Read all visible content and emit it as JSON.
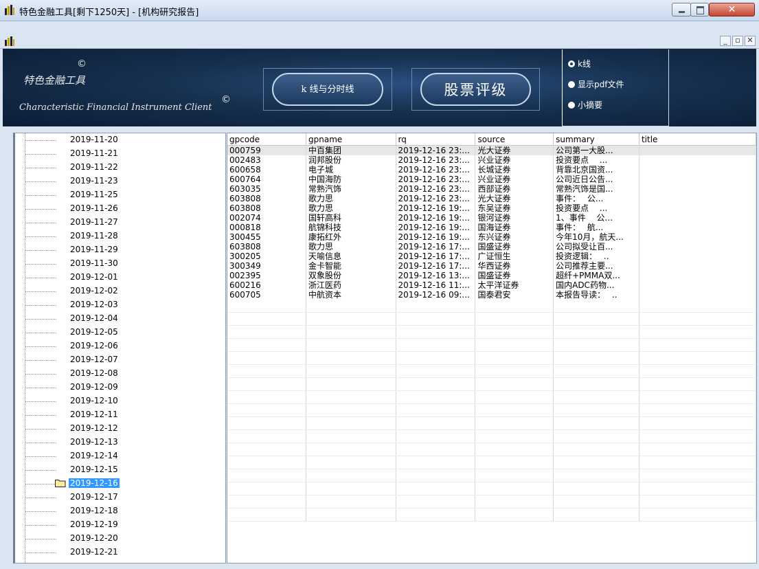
{
  "window": {
    "title": "特色金融工具[剩下1250天] - [机构研究报告]"
  },
  "banner": {
    "logo_cn": "特色金融工具",
    "logo_copyright_1": "©",
    "logo_en": "Characteristic Financial Instrument Client",
    "logo_copyright_2": "©",
    "btn_kline": "k 线与分时线",
    "btn_rating": "股票评级",
    "radios": [
      {
        "label": "k线",
        "selected": true
      },
      {
        "label": "显示pdf文件",
        "selected": false
      },
      {
        "label": "小摘要",
        "selected": false
      }
    ]
  },
  "tree": {
    "items": [
      "2019-11-20",
      "2019-11-21",
      "2019-11-22",
      "2019-11-23",
      "2019-11-25",
      "2019-11-26",
      "2019-11-27",
      "2019-11-28",
      "2019-11-29",
      "2019-11-30",
      "2019-12-01",
      "2019-12-02",
      "2019-12-03",
      "2019-12-04",
      "2019-12-05",
      "2019-12-06",
      "2019-12-07",
      "2019-12-08",
      "2019-12-09",
      "2019-12-10",
      "2019-12-11",
      "2019-12-12",
      "2019-12-13",
      "2019-12-14",
      "2019-12-15",
      "2019-12-16",
      "2019-12-17",
      "2019-12-18",
      "2019-12-19",
      "2019-12-20",
      "2019-12-21"
    ],
    "selected": "2019-12-16"
  },
  "grid": {
    "columns": [
      "gpcode",
      "gpname",
      "rq",
      "source",
      "summary",
      "title"
    ],
    "rows": [
      [
        "000759",
        "中百集团",
        "2019-12-16 23:...",
        "光大证券",
        "公司第一大股...",
        ""
      ],
      [
        "002483",
        "润邦股份",
        "2019-12-16 23:...",
        "兴业证券",
        "投资要点　 ...",
        ""
      ],
      [
        "600658",
        "电子城",
        "2019-12-16 23:...",
        "长城证券",
        "背靠北京国资...",
        ""
      ],
      [
        "600764",
        "中国海防",
        "2019-12-16 23:...",
        "兴业证券",
        "公司近日公告...",
        ""
      ],
      [
        "603035",
        "常熟汽饰",
        "2019-12-16 23:...",
        "西部证券",
        "常熟汽饰是国...",
        ""
      ],
      [
        "603808",
        "歌力思",
        "2019-12-16 23:...",
        "光大证券",
        "事件：　 公...",
        ""
      ],
      [
        "603808",
        "歌力思",
        "2019-12-16 19:...",
        "东吴证券",
        "投资要点　 ...",
        ""
      ],
      [
        "002074",
        "国轩高科",
        "2019-12-16 19:...",
        "银河证券",
        "1、事件　 公...",
        ""
      ],
      [
        "000818",
        "航锦科技",
        "2019-12-16 19:...",
        "国海证券",
        "事件：　 航...",
        ""
      ],
      [
        "300455",
        "康拓红外",
        "2019-12-16 19:...",
        "东兴证券",
        "今年10月，航天...",
        ""
      ],
      [
        "603808",
        "歌力思",
        "2019-12-16 17:...",
        "国盛证券",
        "公司拟受让百...",
        ""
      ],
      [
        "300205",
        "天喻信息",
        "2019-12-16 17:...",
        "广证恒生",
        "投资逻辑：　 ..",
        ""
      ],
      [
        "300349",
        "金卡智能",
        "2019-12-16 17:...",
        "华西证券",
        "公司推荐主要...",
        ""
      ],
      [
        "002395",
        "双象股份",
        "2019-12-16 13:...",
        "国盛证券",
        "超纤+PMMA双...",
        ""
      ],
      [
        "600216",
        "浙江医药",
        "2019-12-16 11:...",
        "太平洋证券",
        "国内ADC药物...",
        ""
      ],
      [
        "600705",
        "中航资本",
        "2019-12-16 09:...",
        "国泰君安",
        "本报告导读：　 ..",
        ""
      ]
    ]
  }
}
